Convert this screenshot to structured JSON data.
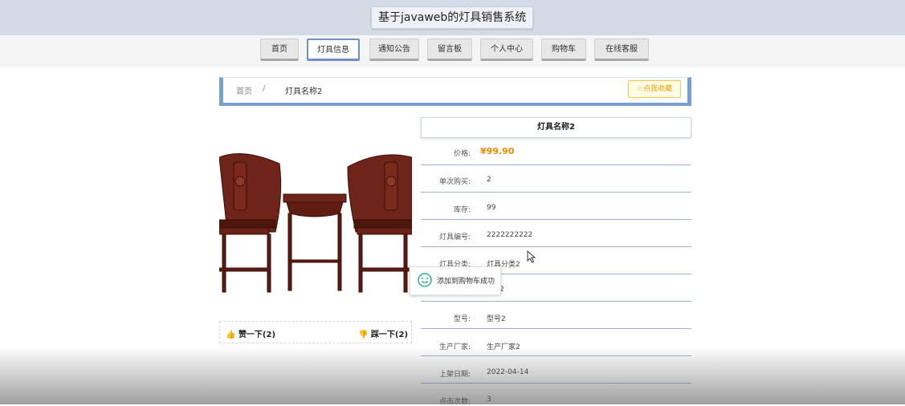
{
  "header": {
    "site_title": "基于javaweb的灯具销售系统"
  },
  "nav": [
    "首页",
    "灯具信息",
    "通知公告",
    "留言板",
    "个人中心",
    "购物车",
    "在线客服"
  ],
  "breadcrumb": {
    "home": "首页",
    "sep": "/",
    "current": "灯具名称2"
  },
  "favorite_label": "点我收藏",
  "product": {
    "name": "灯具名称2",
    "fields": [
      {
        "label": "价格:",
        "value": "¥99.90"
      },
      {
        "label": "单次购买:",
        "value": "2"
      },
      {
        "label": "库存:",
        "value": "99"
      },
      {
        "label": "灯具编号:",
        "value": "2222222222"
      },
      {
        "label": "灯具分类:",
        "value": "灯具分类2"
      },
      {
        "label": "",
        "value": "2"
      },
      {
        "label": "型号:",
        "value": "型号2"
      },
      {
        "label": "生产厂家:",
        "value": "生产厂家2"
      },
      {
        "label": "上架日期:",
        "value": "2022-04-14"
      },
      {
        "label": "点击次数:",
        "value": "3"
      }
    ]
  },
  "vote": {
    "like": "赞一下(2)",
    "dislike": "踩一下(2)"
  },
  "toast": {
    "message": "添加到购物车成功"
  },
  "colors": {
    "accent": "#7b9ed1",
    "price": "#f08a00",
    "favorite": "#e8a800",
    "toast_icon": "#2fb380",
    "vote_icon": "#e0442b"
  }
}
